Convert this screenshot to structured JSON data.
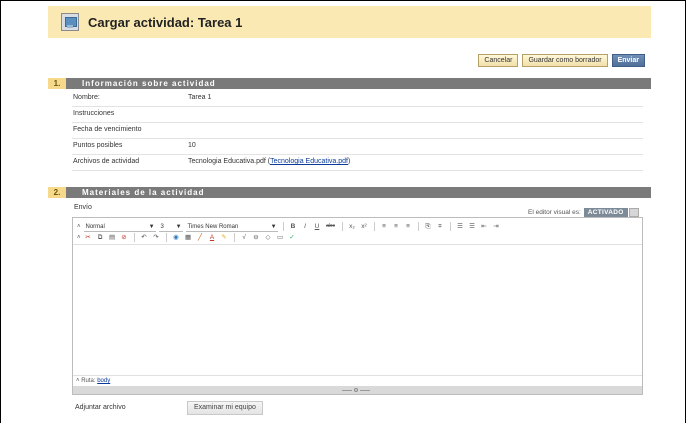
{
  "header": {
    "title": "Cargar actividad: Tarea 1",
    "icon": "assignment-icon"
  },
  "actions": {
    "cancel": "Cancelar",
    "save_draft": "Guardar como borrador",
    "submit": "Enviar"
  },
  "section1": {
    "number": "1.",
    "title": "Información sobre actividad",
    "rows": [
      {
        "label": "Nombre:",
        "value": "Tarea 1"
      },
      {
        "label": "Instrucciones",
        "value": ""
      },
      {
        "label": "Fecha de vencimiento",
        "value": ""
      },
      {
        "label": "Puntos posibles",
        "value": "10"
      },
      {
        "label": "Archivos de actividad",
        "value": "Tecnologia Educativa.pdf",
        "link": "Tecnologia Educativa.pdf"
      }
    ]
  },
  "section2": {
    "number": "2.",
    "title": "Materiales de la actividad",
    "envio_label": "Envío",
    "visual_editor_label": "El editor visual es:",
    "visual_editor_state": "ACTIVADO",
    "toolbar": {
      "format": "Normal",
      "size": "3",
      "font": "Times New Roman"
    },
    "path_label": "Ruta:",
    "path_value": "body"
  },
  "attach": {
    "label": "Adjuntar archivo",
    "button": "Examinar mi equipo"
  },
  "colors": {
    "header_bg": "#fbe9b4",
    "section_bar": "#7a7a7a",
    "section_num_bg": "#f6d98a",
    "primary_button": "#4f6f99",
    "link": "#0a3a9a"
  }
}
